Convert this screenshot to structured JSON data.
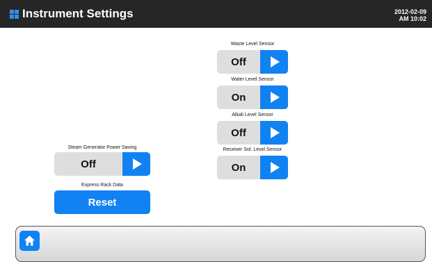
{
  "header": {
    "title": "Instrument Settings",
    "date": "2012-02-09",
    "time": "AM 10:02",
    "logo_icon": "grid-icon"
  },
  "settings": {
    "waste_level": {
      "label": "Waste Level Sensor",
      "value": "Off"
    },
    "water_level": {
      "label": "Water Level Sensor",
      "value": "On"
    },
    "alkali_level": {
      "label": "Alkali Level Sensor",
      "value": "Off"
    },
    "receiver_level": {
      "label": "Receiver Sol. Level Sensor",
      "value": "On"
    },
    "steam_generator": {
      "label": "Steam Generator Power Saving",
      "value": "Off"
    },
    "express_rack": {
      "label": "Express Rack Data",
      "button": "Reset"
    }
  },
  "footer": {
    "home_icon": "home-icon"
  },
  "colors": {
    "accent": "#1182f2",
    "header_bg": "#262626",
    "toggle_bg": "#dedede"
  }
}
